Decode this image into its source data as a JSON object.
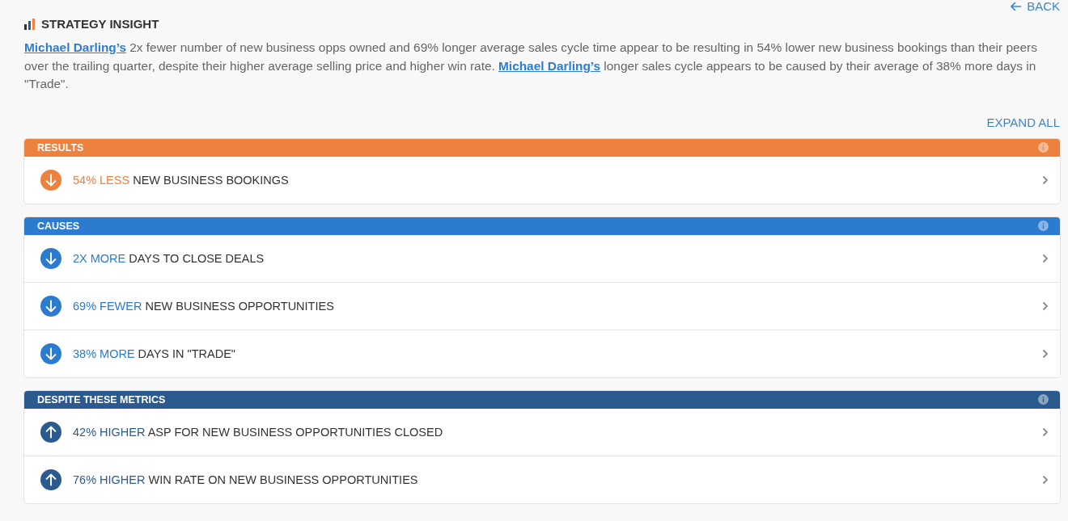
{
  "back": {
    "label": "BACK"
  },
  "title": "STRATEGY INSIGHT",
  "summary": [
    {
      "kind": "link",
      "text": "Michael Darling’s"
    },
    {
      "kind": "text",
      "text": " 2x fewer number of new business opps owned and 69% longer average sales cycle time appear to be resulting in 54% lower new business bookings than their peers over the trailing quarter, despite their higher average selling price and higher win rate. "
    },
    {
      "kind": "link",
      "text": "Michael Darling’s"
    },
    {
      "kind": "text",
      "text": " longer sales cycle appears to be caused by their average of 38% more days in \"Trade\"."
    }
  ],
  "expand_all": "EXPAND ALL",
  "sections": [
    {
      "title": "RESULTS",
      "color": "#ed813e",
      "rows": [
        {
          "up": false,
          "highlight": "54% LESS",
          "text": "NEW BUSINESS BOOKINGS"
        }
      ]
    },
    {
      "title": "CAUSES",
      "color": "#2b7bd0",
      "rows": [
        {
          "up": false,
          "highlight": "2X MORE",
          "text": "DAYS TO CLOSE DEALS"
        },
        {
          "up": false,
          "highlight": "69% FEWER",
          "text": "NEW BUSINESS OPPORTUNITIES"
        },
        {
          "up": false,
          "highlight": "38% MORE",
          "text": "DAYS IN \"TRADE\""
        }
      ]
    },
    {
      "title": "DESPITE THESE METRICS",
      "color": "#2b5a8e",
      "rows": [
        {
          "up": true,
          "highlight": "42% HIGHER",
          "text": "ASP FOR NEW BUSINESS OPPORTUNITIES CLOSED"
        },
        {
          "up": true,
          "highlight": "76% HIGHER",
          "text": "WIN RATE ON NEW BUSINESS OPPORTUNITIES"
        }
      ]
    }
  ]
}
